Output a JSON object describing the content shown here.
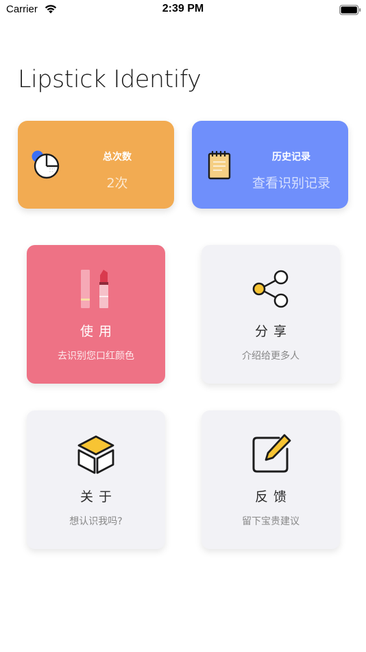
{
  "status_bar": {
    "carrier": "Carrier",
    "time": "2:39 PM"
  },
  "header": {
    "title": "Lipstick Identify"
  },
  "stats": {
    "total": {
      "title": "总次数",
      "value": "2次",
      "icon": "pie-chart-icon",
      "color": "#f2ab52"
    },
    "history": {
      "title": "历史记录",
      "value": "查看识别记录",
      "icon": "notepad-icon",
      "color": "#6f8ffb"
    }
  },
  "tiles": {
    "use": {
      "label": "使用",
      "subtitle": "去识别您口红颜色",
      "icon": "lipstick-icon",
      "color": "#ee7285"
    },
    "share": {
      "label": "分享",
      "subtitle": "介绍给更多人",
      "icon": "share-icon"
    },
    "about": {
      "label": "关于",
      "subtitle": "想认识我吗?",
      "icon": "box-icon"
    },
    "feedback": {
      "label": "反馈",
      "subtitle": "留下宝贵建议",
      "icon": "edit-icon"
    }
  }
}
